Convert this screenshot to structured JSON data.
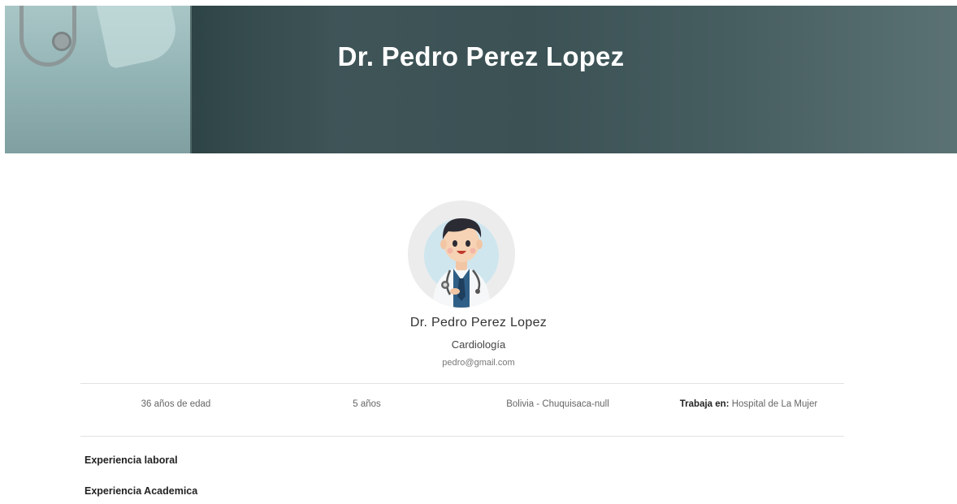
{
  "hero": {
    "title": "Dr. Pedro Perez Lopez"
  },
  "profile": {
    "name": "Dr. Pedro Perez Lopez",
    "specialty": "Cardiología",
    "email": "pedro@gmail.com",
    "avatar_icon": "doctor-avatar-icon"
  },
  "stats": {
    "age": "36 años de edad",
    "experience": "5 años",
    "location": "Bolivia - Chuquisaca-null",
    "works_at_label": "Trabaja en:",
    "works_at_value": "Hospital de La Mujer"
  },
  "sections": {
    "work_experience": "Experiencia laboral",
    "academic_experience": "Experiencia Academica"
  },
  "colors": {
    "hero_overlay": "#3f5558",
    "avatar_bg": "#ececec",
    "divider": "#e2e2e2"
  }
}
